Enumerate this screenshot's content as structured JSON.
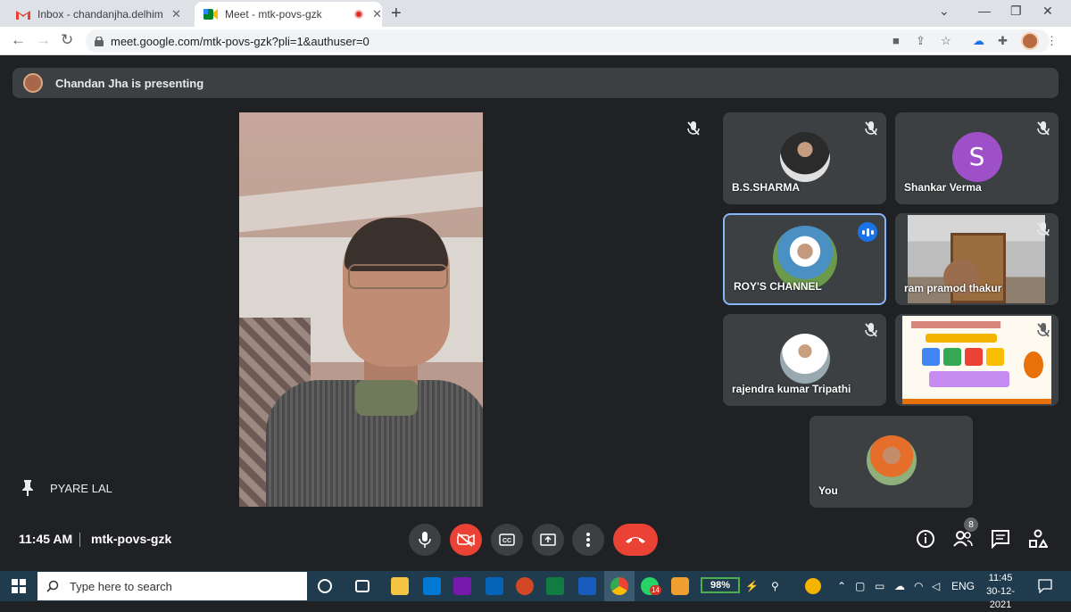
{
  "browser": {
    "tabs": [
      {
        "title": "Inbox - chandanjha.delhimt@gm",
        "icon": "gmail-icon",
        "active": false
      },
      {
        "title": "Meet - mtk-povs-gzk",
        "icon": "meet-icon",
        "active": true,
        "recording": true
      }
    ],
    "url": "meet.google.com/mtk-povs-gzk?pli=1&authuser=0"
  },
  "meeting": {
    "presenting_banner": "Chandan Jha is presenting",
    "pinned_name": "PYARE LAL",
    "time": "11:45 AM",
    "code": "mtk-povs-gzk",
    "participant_count": "8"
  },
  "participants": [
    {
      "name": "B.S.SHARMA",
      "muted": true,
      "avatar": "photo"
    },
    {
      "name": "Shankar Verma",
      "muted": true,
      "avatar": "letter",
      "letter": "S",
      "color": "#9e50c8"
    },
    {
      "name": "ROY'S CHANNEL",
      "muted": false,
      "speaking": true,
      "avatar": "photo"
    },
    {
      "name": "ram pramod thakur",
      "muted": true,
      "avatar": "video"
    },
    {
      "name": "rajendra kumar Tripathi",
      "muted": true,
      "avatar": "photo"
    },
    {
      "name": "",
      "muted": true,
      "avatar": "slide"
    },
    {
      "name": "You",
      "muted": false,
      "avatar": "photo"
    }
  ],
  "taskbar": {
    "search_placeholder": "Type here to search",
    "battery": "98%",
    "language": "ENG",
    "clock_time": "11:45",
    "clock_date": "30-12-2021",
    "whatsapp_badge": "14"
  },
  "colors": {
    "meet_bg": "#202124",
    "tile_bg": "#3c4043",
    "end_call": "#ea4335",
    "active_speaker": "#8ab4f8"
  }
}
